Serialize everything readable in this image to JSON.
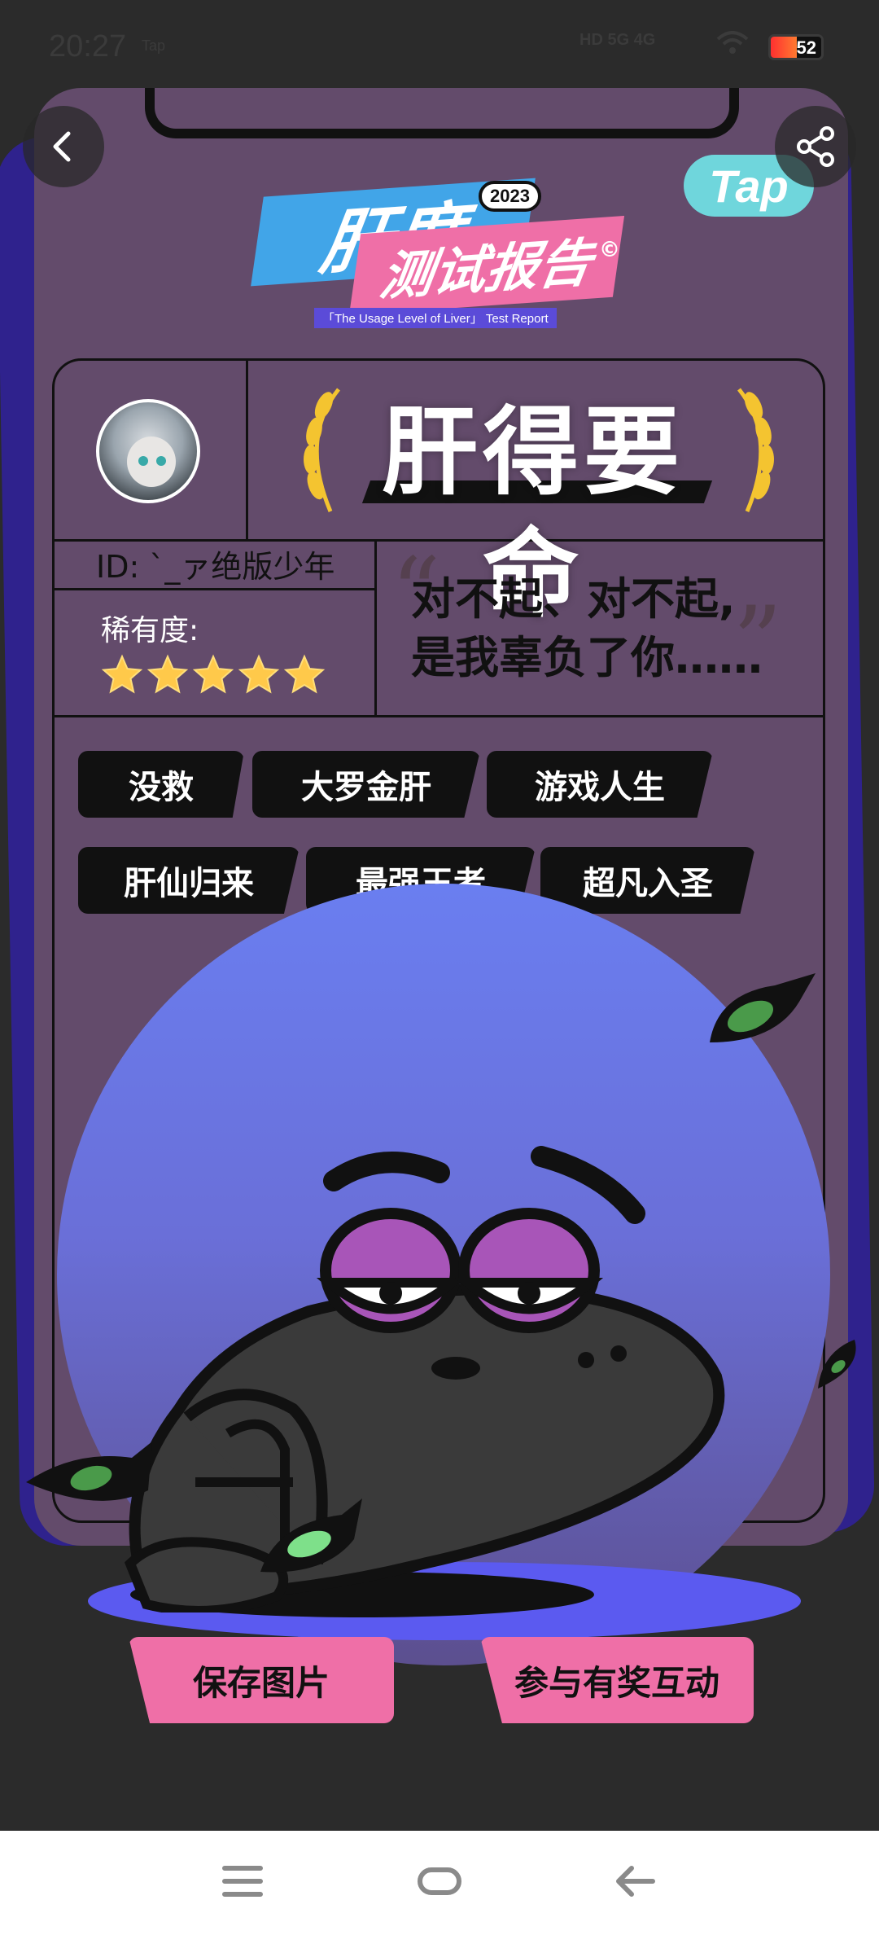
{
  "status_bar": {
    "time": "20:27",
    "app_label": "Tap",
    "network": "HD 5G 4G",
    "battery": "52",
    "battery_level_percent": 52
  },
  "header": {
    "back_icon": "chevron-left-icon",
    "share_icon": "share-icon",
    "brand": "Tap"
  },
  "logo": {
    "line1": "肝度",
    "line2": "测试报告",
    "year": "2023",
    "copyright": "©",
    "subtitle": "「The Usage Level of Liver」 Test Report"
  },
  "report": {
    "title": "肝得要命",
    "user_id": "ID: `_ァ绝版少年",
    "rarity_label": "稀有度:",
    "rarity_stars": 5,
    "quote_line1": "对不起、对不起,",
    "quote_line2": "是我辜负了你……"
  },
  "tags": [
    "没救",
    "大罗金肝",
    "游戏人生",
    "肝仙归来",
    "最强王者",
    "超凡入圣"
  ],
  "actions": {
    "save": "保存图片",
    "interact": "参与有奖互动"
  },
  "colors": {
    "card": "#634b6b",
    "accent_pink": "#ef6fa7",
    "accent_blue": "#41a5e8",
    "tap_cyan": "#6fd6dc",
    "circle": "#6a7ef0"
  }
}
